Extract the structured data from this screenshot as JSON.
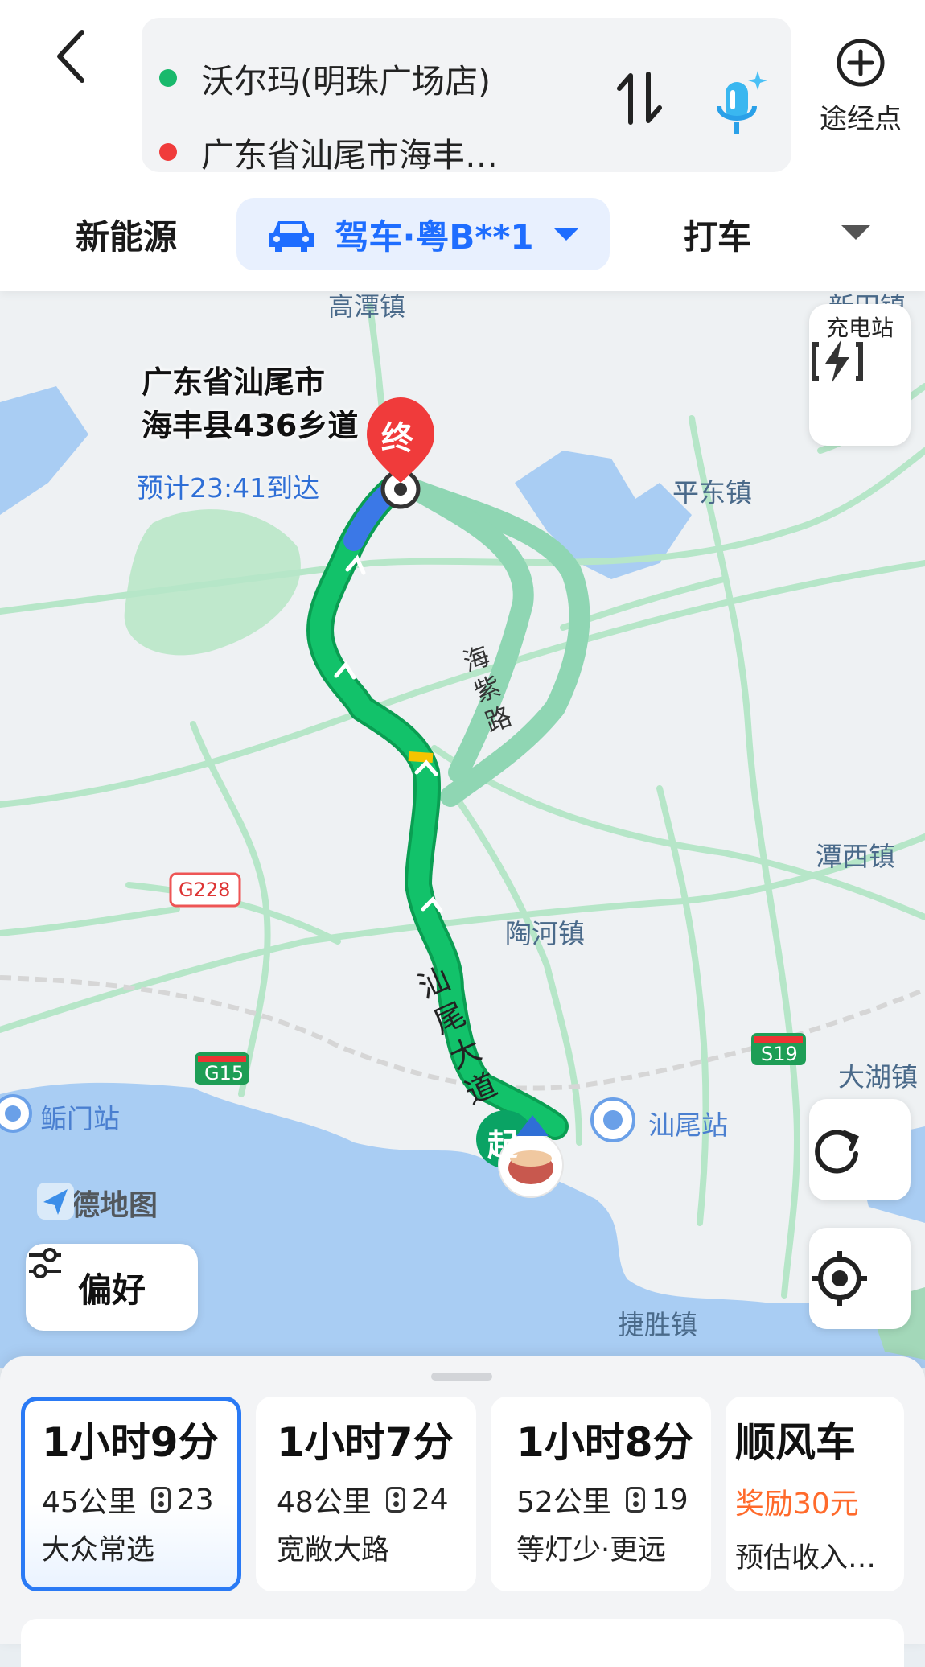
{
  "header": {
    "start": "沃尔玛(明珠广场店)",
    "end": "广东省汕尾市海丰…",
    "waypoint_label": "途经点",
    "colors": {
      "start_dot": "#19b96c",
      "end_dot": "#f03b3b",
      "accent": "#1e6dff"
    }
  },
  "modes": {
    "new_energy": "新能源",
    "drive": "驾车·粤B**1",
    "taxi": "打车"
  },
  "map": {
    "dest_line1": "广东省汕尾市",
    "dest_line2": "海丰县436乡道",
    "eta": "预计23:41到达",
    "end_marker": "终",
    "start_marker": "起",
    "places": {
      "gaotan": "高潭镇",
      "xintian": "新田镇",
      "pingdong": "平东镇",
      "tanxi": "潭西镇",
      "taohe": "陶河镇",
      "dahu": "大湖镇",
      "jiesheng": "捷胜镇",
      "shanwei_station": "汕尾站",
      "bomen_station": "鲘门站"
    },
    "roads": {
      "haizi": "海紫路",
      "shanwei_ave": "汕尾大道",
      "g228": "G228",
      "g15": "G15",
      "s19": "S19"
    },
    "brand": "高德地图",
    "charge_label": "充电站",
    "preference_label": "偏好"
  },
  "routes": [
    {
      "time": "1小时9分",
      "distance": "45公里",
      "lights": "23",
      "tag": "大众常选"
    },
    {
      "time": "1小时7分",
      "distance": "48公里",
      "lights": "24",
      "tag": "宽敞大路"
    },
    {
      "time": "1小时8分",
      "distance": "52公里",
      "lights": "19",
      "tag": "等灯少·更远"
    },
    {
      "title": "顺风车",
      "reward": "奖励30元",
      "income": "预估收入…"
    }
  ]
}
